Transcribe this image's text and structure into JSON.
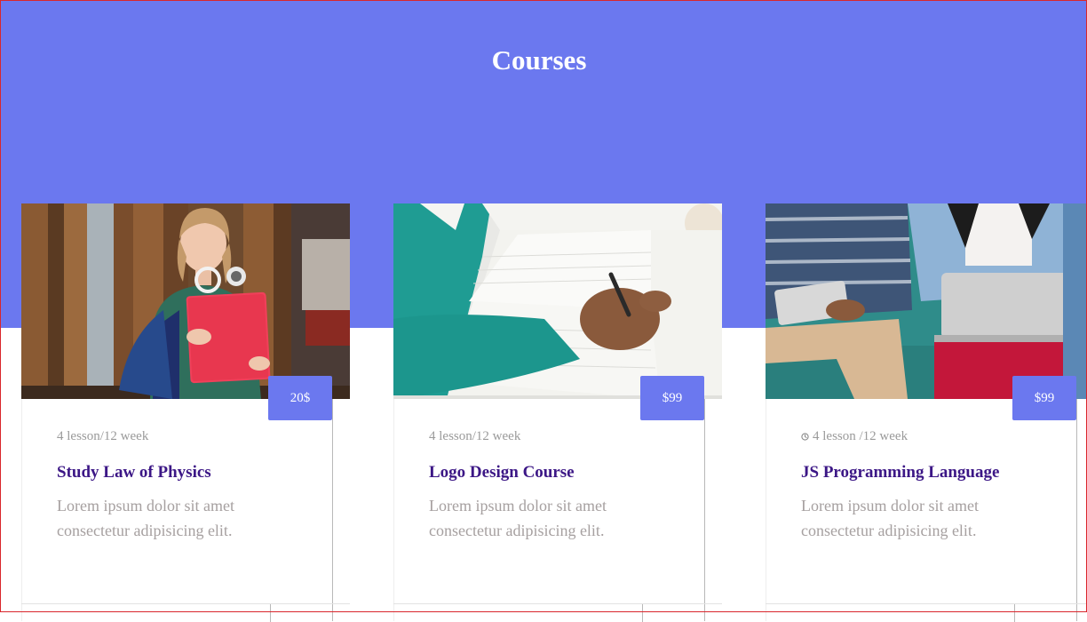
{
  "header": {
    "title": "Courses"
  },
  "colors": {
    "accent": "#6b78ef",
    "title": "#3c1786",
    "muted": "#9a9a9a",
    "description": "#a6a0a0"
  },
  "courses": [
    {
      "image": "student-girl-holding-red-folder",
      "price": "20$",
      "meta": "4 lesson/12 week",
      "meta_icon": "",
      "title": "Study Law of Physics",
      "description": "Lorem ipsum dolor sit amet consectetur adipisicing elit."
    },
    {
      "image": "hand-writing-in-notebook",
      "price": "$99",
      "meta": "4 lesson/12 week",
      "meta_icon": "",
      "title": "Logo Design Course",
      "description": "Lorem ipsum dolor sit amet consectetur adipisicing elit."
    },
    {
      "image": "people-with-tablet-and-laptop",
      "price": "$99",
      "meta": "4 lesson /12 week",
      "meta_icon": "clock-icon",
      "title": "JS Programming Language",
      "description": "Lorem ipsum dolor sit amet consectetur adipisicing elit."
    }
  ]
}
